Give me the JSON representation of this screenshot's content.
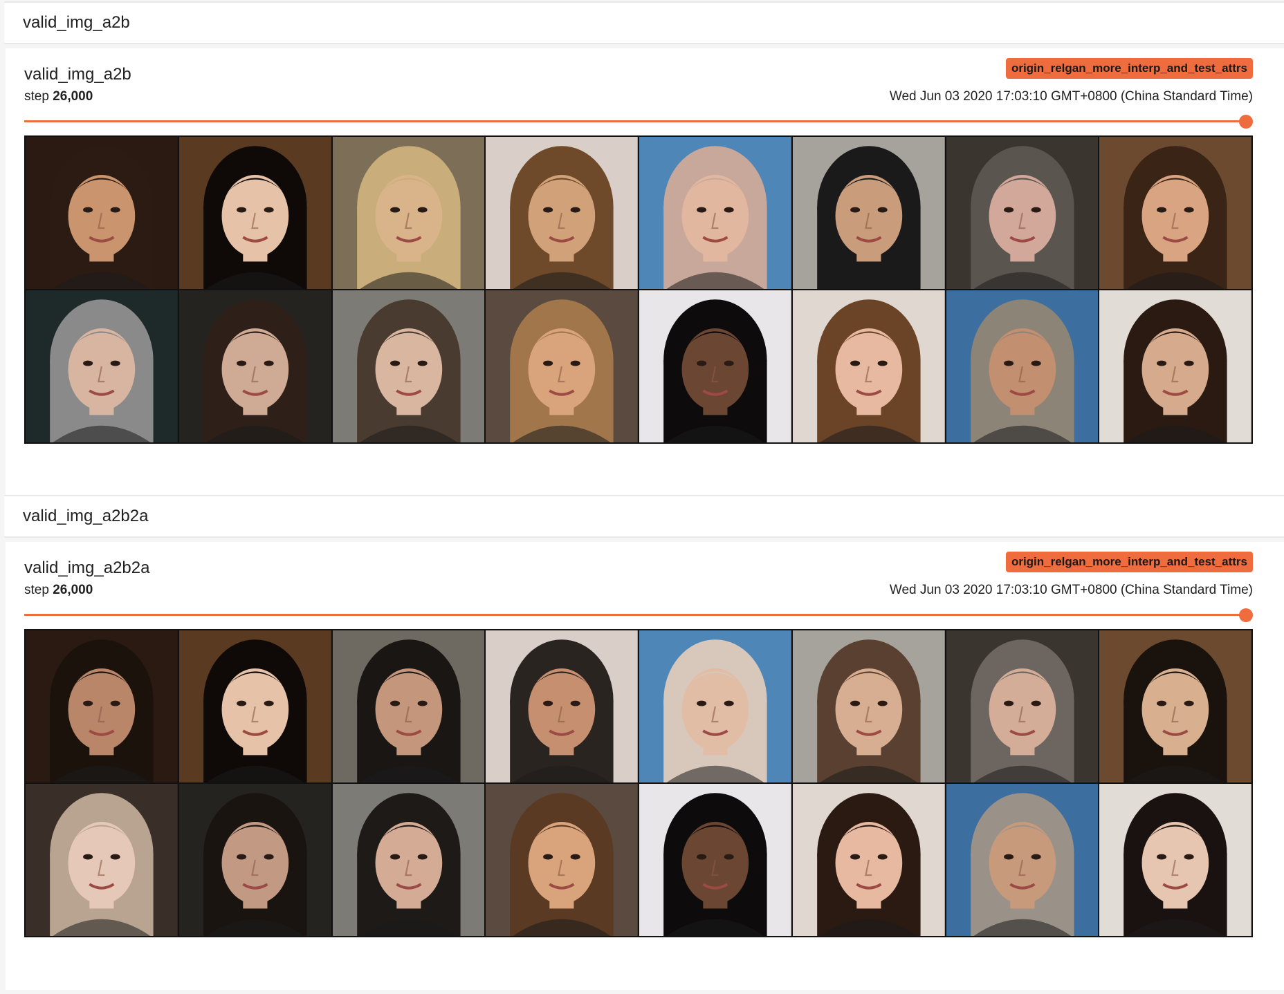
{
  "sections": [
    {
      "group_title": "valid_img_a2b",
      "card_title": "valid_img_a2b",
      "step_label": "step",
      "step_value": "26,000",
      "run_badge": "origin_relgan_more_interp_and_test_attrs",
      "timestamp": "Wed Jun 03 2020 17:03:10 GMT+0800 (China Standard Time)",
      "slider_position": 1.0,
      "accent_color": "#ef6c3f",
      "tiles": [
        {
          "bg": "#2a1a12",
          "skin": "#c9946e",
          "hair": "#2b1b12"
        },
        {
          "bg": "#5a3b22",
          "skin": "#e6c2a8",
          "hair": "#0f0a08"
        },
        {
          "bg": "#7d6e57",
          "skin": "#d9b48a",
          "hair": "#c9ad7a"
        },
        {
          "bg": "#d9cfc8",
          "skin": "#d1a27a",
          "hair": "#6e4a2a"
        },
        {
          "bg": "#4f86b8",
          "skin": "#e2b7a0",
          "hair": "#c8a89a"
        },
        {
          "bg": "#a6a39d",
          "skin": "#c99d7b",
          "hair": "#1a1a1a"
        },
        {
          "bg": "#3b3530",
          "skin": "#d2a89a",
          "hair": "#5b5550"
        },
        {
          "bg": "#6b4a30",
          "skin": "#d8a481",
          "hair": "#3a2416"
        },
        {
          "bg": "#1d2a29",
          "skin": "#d8b5a0",
          "hair": "#8a8a8a"
        },
        {
          "bg": "#24231f",
          "skin": "#cfaa94",
          "hair": "#2e1f18"
        },
        {
          "bg": "#7d7b76",
          "skin": "#d9b6a0",
          "hair": "#4a3b30"
        },
        {
          "bg": "#5a4a40",
          "skin": "#d9a37c",
          "hair": "#a0764a"
        },
        {
          "bg": "#e8e6e8",
          "skin": "#6b4632",
          "hair": "#0d0b0b"
        },
        {
          "bg": "#e0d8d0",
          "skin": "#e6b9a0",
          "hair": "#6b4428"
        },
        {
          "bg": "#3d6ea0",
          "skin": "#c28f70",
          "hair": "#8d8478"
        },
        {
          "bg": "#e2dcd6",
          "skin": "#d6aa8c",
          "hair": "#2a1a12"
        }
      ]
    },
    {
      "group_title": "valid_img_a2b2a",
      "card_title": "valid_img_a2b2a",
      "step_label": "step",
      "step_value": "26,000",
      "run_badge": "origin_relgan_more_interp_and_test_attrs",
      "timestamp": "Wed Jun 03 2020 17:03:10 GMT+0800 (China Standard Time)",
      "slider_position": 1.0,
      "accent_color": "#ef6c3f",
      "tiles": [
        {
          "bg": "#2a1a12",
          "skin": "#b9866a",
          "hair": "#1b120c"
        },
        {
          "bg": "#5a3b22",
          "skin": "#e6c2a8",
          "hair": "#0f0a08"
        },
        {
          "bg": "#6e6a62",
          "skin": "#c4977c",
          "hair": "#1a1614"
        },
        {
          "bg": "#d9cfc8",
          "skin": "#c69070",
          "hair": "#2a2420"
        },
        {
          "bg": "#4f86b8",
          "skin": "#e2bda6",
          "hair": "#d8c8bc"
        },
        {
          "bg": "#a6a39d",
          "skin": "#d8ae92",
          "hair": "#5a4030"
        },
        {
          "bg": "#3b3530",
          "skin": "#d4ad98",
          "hair": "#6d6660"
        },
        {
          "bg": "#6b4a30",
          "skin": "#d8b090",
          "hair": "#1a120c"
        },
        {
          "bg": "#3a2e28",
          "skin": "#e6c8b8",
          "hair": "#b8a490"
        },
        {
          "bg": "#24231f",
          "skin": "#c29a84",
          "hair": "#1a1410"
        },
        {
          "bg": "#7d7b76",
          "skin": "#d4ab94",
          "hair": "#1e1a18"
        },
        {
          "bg": "#5a4a40",
          "skin": "#d9a37c",
          "hair": "#5a3a22"
        },
        {
          "bg": "#e8e6e8",
          "skin": "#6b4632",
          "hair": "#0d0b0b"
        },
        {
          "bg": "#e0d8d0",
          "skin": "#e6b9a0",
          "hair": "#2a1a12"
        },
        {
          "bg": "#3d6ea0",
          "skin": "#c89a7c",
          "hair": "#9a9288"
        },
        {
          "bg": "#e2dcd6",
          "skin": "#e6c6b0",
          "hair": "#1a1210"
        }
      ]
    }
  ]
}
